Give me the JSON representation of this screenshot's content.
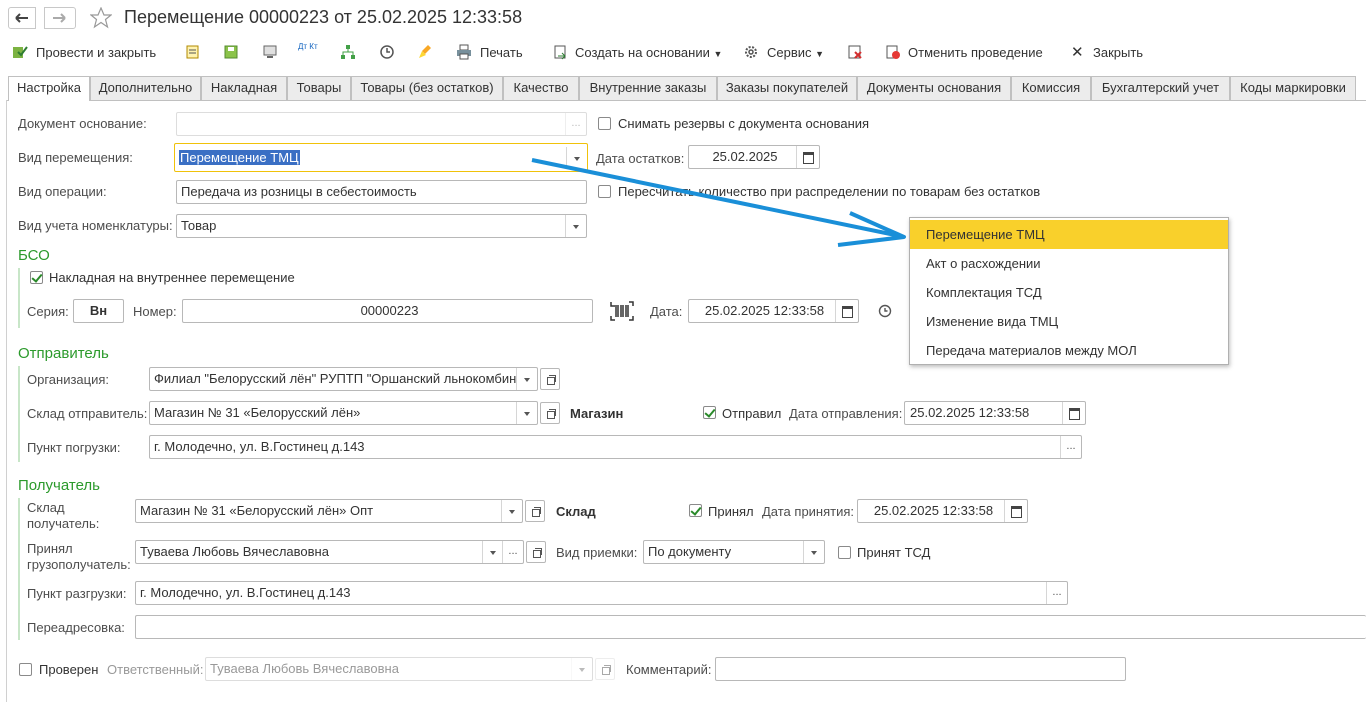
{
  "window": {
    "title": "Перемещение 00000223 от 25.02.2025 12:33:58"
  },
  "toolbar": {
    "post_close": "Провести и закрыть",
    "print": "Печать",
    "create_based": "Создать на основании",
    "service": "Сервис",
    "unpost": "Отменить проведение",
    "close": "Закрыть",
    "dt_kt": "Дт Кт"
  },
  "tabs": [
    "Настройка",
    "Дополнительно",
    "Накладная",
    "Товары",
    "Товары (без остатков)",
    "Качество",
    "Внутренние заказы",
    "Заказы покупателей",
    "Документы основания",
    "Комиссия",
    "Бухгалтерский учет",
    "Коды маркировки"
  ],
  "form": {
    "doc_basis_label": "Документ основание:",
    "doc_basis_value": "",
    "release_reserves_label": "Снимать резервы с документа основания",
    "movement_type_label": "Вид перемещения:",
    "movement_type_value": "Перемещение ТМЦ",
    "stock_date_label": "Дата остатков:",
    "stock_date_value": "25.02.2025",
    "operation_type_label": "Вид операции:",
    "operation_type_value": "Передача из розницы в себестоимость",
    "recalc_label": "Пересчитать количество при распределении по товарам без остатков",
    "nomenclature_label": "Вид учета номенклатуры:",
    "nomenclature_value": "Товар"
  },
  "bso": {
    "title": "БСО",
    "waybill_label": "Накладная на внутреннее перемещение",
    "series_label": "Серия:",
    "series_value": "Вн",
    "number_label": "Номер:",
    "number_value": "00000223",
    "date_label": "Дата:",
    "date_value": "25.02.2025 12:33:58"
  },
  "dropdown": {
    "items": [
      "Перемещение ТМЦ",
      "Акт о расхождении",
      "Комплектация ТСД",
      "Изменение вида ТМЦ",
      "Передача материалов между МОЛ"
    ]
  },
  "sender": {
    "title": "Отправитель",
    "org_label": "Организация:",
    "org_value": "Филиал \"Белорусский лён\" РУПТП \"Оршанский льнокомбин",
    "warehouse_label": "Склад отправитель:",
    "warehouse_value": "Магазин № 31 «Белорусский лён»",
    "warehouse_type": "Магазин",
    "sent_label": "Отправил",
    "sent_date_label": "Дата отправления:",
    "sent_date_value": "25.02.2025 12:33:58",
    "loading_label": "Пункт погрузки:",
    "loading_value": "г. Молодечно, ул. В.Гостинец д.143"
  },
  "receiver": {
    "title": "Получатель",
    "warehouse_label_1": "Склад",
    "warehouse_label_2": "получатель:",
    "warehouse_value": "Магазин № 31 «Белорусский лён» Опт",
    "warehouse_type": "Склад",
    "accepted_label": "Принял",
    "accepted_date_label": "Дата принятия:",
    "accepted_date_value": "25.02.2025 12:33:58",
    "consignee_label_1": "Принял",
    "consignee_label_2": "грузополучатель:",
    "consignee_value": "Туваева Любовь Вячеславовна",
    "acceptance_type_label": "Вид приемки:",
    "acceptance_type_value": "По документу",
    "tsd_label": "Принят ТСД",
    "unloading_label": "Пункт разгрузки:",
    "unloading_value": "г. Молодечно, ул. В.Гостинец д.143",
    "redirect_label": "Переадресовка:",
    "redirect_value": ""
  },
  "footer": {
    "checked_label": "Проверен",
    "responsible_label": "Ответственный:",
    "responsible_value": "Туваева  Любовь  Вячеславовна",
    "comment_label": "Комментарий:",
    "comment_value": ""
  }
}
